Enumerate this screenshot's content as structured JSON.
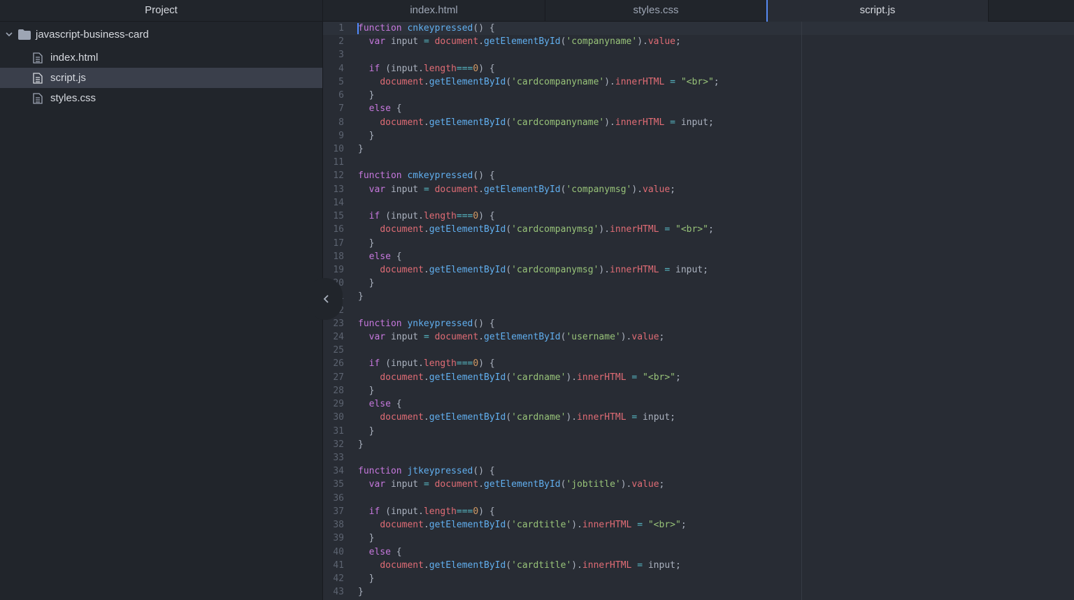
{
  "sidebar": {
    "title": "Project",
    "folder": {
      "name": "javascript-business-card",
      "expanded": true
    },
    "files": [
      {
        "name": "index.html",
        "selected": false
      },
      {
        "name": "script.js",
        "selected": true
      },
      {
        "name": "styles.css",
        "selected": false
      }
    ]
  },
  "tabs": [
    {
      "label": "index.html",
      "active": false
    },
    {
      "label": "styles.css",
      "active": false
    },
    {
      "label": "script.js",
      "active": true
    }
  ],
  "editor": {
    "first_line_number": 1,
    "colors": {
      "keyword": "#c678dd",
      "function": "#61afef",
      "variable": "#e06c75",
      "string": "#98c379",
      "number": "#d19a66",
      "operator": "#56b6c2",
      "text": "#abb2bf",
      "cursor": "#528bff"
    },
    "lines": [
      [
        [
          "k",
          "function"
        ],
        [
          "p",
          " "
        ],
        [
          "f",
          "cnkeypressed"
        ],
        [
          "p",
          "() {"
        ]
      ],
      [
        [
          "p",
          "  "
        ],
        [
          "k",
          "var"
        ],
        [
          "p",
          " input "
        ],
        [
          "o",
          "="
        ],
        [
          "p",
          " "
        ],
        [
          "v",
          "document"
        ],
        [
          "p",
          "."
        ],
        [
          "f",
          "getElementById"
        ],
        [
          "p",
          "("
        ],
        [
          "s",
          "'companyname'"
        ],
        [
          "p",
          ")."
        ],
        [
          "v",
          "value"
        ],
        [
          "p",
          ";"
        ]
      ],
      [],
      [
        [
          "p",
          "  "
        ],
        [
          "k",
          "if"
        ],
        [
          "p",
          " (input."
        ],
        [
          "v",
          "length"
        ],
        [
          "o",
          "==="
        ],
        [
          "n",
          "0"
        ],
        [
          "p",
          ") {"
        ]
      ],
      [
        [
          "p",
          "    "
        ],
        [
          "v",
          "document"
        ],
        [
          "p",
          "."
        ],
        [
          "f",
          "getElementById"
        ],
        [
          "p",
          "("
        ],
        [
          "s",
          "'cardcompanyname'"
        ],
        [
          "p",
          ")."
        ],
        [
          "v",
          "innerHTML"
        ],
        [
          "p",
          " "
        ],
        [
          "o",
          "="
        ],
        [
          "p",
          " "
        ],
        [
          "s",
          "\"<br>\""
        ],
        [
          "p",
          ";"
        ]
      ],
      [
        [
          "p",
          "  }"
        ]
      ],
      [
        [
          "p",
          "  "
        ],
        [
          "k",
          "else"
        ],
        [
          "p",
          " {"
        ]
      ],
      [
        [
          "p",
          "    "
        ],
        [
          "v",
          "document"
        ],
        [
          "p",
          "."
        ],
        [
          "f",
          "getElementById"
        ],
        [
          "p",
          "("
        ],
        [
          "s",
          "'cardcompanyname'"
        ],
        [
          "p",
          ")."
        ],
        [
          "v",
          "innerHTML"
        ],
        [
          "p",
          " "
        ],
        [
          "o",
          "="
        ],
        [
          "p",
          " input;"
        ]
      ],
      [
        [
          "p",
          "  }"
        ]
      ],
      [
        [
          "p",
          "}"
        ]
      ],
      [],
      [
        [
          "k",
          "function"
        ],
        [
          "p",
          " "
        ],
        [
          "f",
          "cmkeypressed"
        ],
        [
          "p",
          "() {"
        ]
      ],
      [
        [
          "p",
          "  "
        ],
        [
          "k",
          "var"
        ],
        [
          "p",
          " input "
        ],
        [
          "o",
          "="
        ],
        [
          "p",
          " "
        ],
        [
          "v",
          "document"
        ],
        [
          "p",
          "."
        ],
        [
          "f",
          "getElementById"
        ],
        [
          "p",
          "("
        ],
        [
          "s",
          "'companymsg'"
        ],
        [
          "p",
          ")."
        ],
        [
          "v",
          "value"
        ],
        [
          "p",
          ";"
        ]
      ],
      [],
      [
        [
          "p",
          "  "
        ],
        [
          "k",
          "if"
        ],
        [
          "p",
          " (input."
        ],
        [
          "v",
          "length"
        ],
        [
          "o",
          "==="
        ],
        [
          "n",
          "0"
        ],
        [
          "p",
          ") {"
        ]
      ],
      [
        [
          "p",
          "    "
        ],
        [
          "v",
          "document"
        ],
        [
          "p",
          "."
        ],
        [
          "f",
          "getElementById"
        ],
        [
          "p",
          "("
        ],
        [
          "s",
          "'cardcompanymsg'"
        ],
        [
          "p",
          ")."
        ],
        [
          "v",
          "innerHTML"
        ],
        [
          "p",
          " "
        ],
        [
          "o",
          "="
        ],
        [
          "p",
          " "
        ],
        [
          "s",
          "\"<br>\""
        ],
        [
          "p",
          ";"
        ]
      ],
      [
        [
          "p",
          "  }"
        ]
      ],
      [
        [
          "p",
          "  "
        ],
        [
          "k",
          "else"
        ],
        [
          "p",
          " {"
        ]
      ],
      [
        [
          "p",
          "    "
        ],
        [
          "v",
          "document"
        ],
        [
          "p",
          "."
        ],
        [
          "f",
          "getElementById"
        ],
        [
          "p",
          "("
        ],
        [
          "s",
          "'cardcompanymsg'"
        ],
        [
          "p",
          ")."
        ],
        [
          "v",
          "innerHTML"
        ],
        [
          "p",
          " "
        ],
        [
          "o",
          "="
        ],
        [
          "p",
          " input;"
        ]
      ],
      [
        [
          "p",
          "  }"
        ]
      ],
      [
        [
          "p",
          "}"
        ]
      ],
      [],
      [
        [
          "k",
          "function"
        ],
        [
          "p",
          " "
        ],
        [
          "f",
          "ynkeypressed"
        ],
        [
          "p",
          "() {"
        ]
      ],
      [
        [
          "p",
          "  "
        ],
        [
          "k",
          "var"
        ],
        [
          "p",
          " input "
        ],
        [
          "o",
          "="
        ],
        [
          "p",
          " "
        ],
        [
          "v",
          "document"
        ],
        [
          "p",
          "."
        ],
        [
          "f",
          "getElementById"
        ],
        [
          "p",
          "("
        ],
        [
          "s",
          "'username'"
        ],
        [
          "p",
          ")."
        ],
        [
          "v",
          "value"
        ],
        [
          "p",
          ";"
        ]
      ],
      [],
      [
        [
          "p",
          "  "
        ],
        [
          "k",
          "if"
        ],
        [
          "p",
          " (input."
        ],
        [
          "v",
          "length"
        ],
        [
          "o",
          "==="
        ],
        [
          "n",
          "0"
        ],
        [
          "p",
          ") {"
        ]
      ],
      [
        [
          "p",
          "    "
        ],
        [
          "v",
          "document"
        ],
        [
          "p",
          "."
        ],
        [
          "f",
          "getElementById"
        ],
        [
          "p",
          "("
        ],
        [
          "s",
          "'cardname'"
        ],
        [
          "p",
          ")."
        ],
        [
          "v",
          "innerHTML"
        ],
        [
          "p",
          " "
        ],
        [
          "o",
          "="
        ],
        [
          "p",
          " "
        ],
        [
          "s",
          "\"<br>\""
        ],
        [
          "p",
          ";"
        ]
      ],
      [
        [
          "p",
          "  }"
        ]
      ],
      [
        [
          "p",
          "  "
        ],
        [
          "k",
          "else"
        ],
        [
          "p",
          " {"
        ]
      ],
      [
        [
          "p",
          "    "
        ],
        [
          "v",
          "document"
        ],
        [
          "p",
          "."
        ],
        [
          "f",
          "getElementById"
        ],
        [
          "p",
          "("
        ],
        [
          "s",
          "'cardname'"
        ],
        [
          "p",
          ")."
        ],
        [
          "v",
          "innerHTML"
        ],
        [
          "p",
          " "
        ],
        [
          "o",
          "="
        ],
        [
          "p",
          " input;"
        ]
      ],
      [
        [
          "p",
          "  }"
        ]
      ],
      [
        [
          "p",
          "}"
        ]
      ],
      [],
      [
        [
          "k",
          "function"
        ],
        [
          "p",
          " "
        ],
        [
          "f",
          "jtkeypressed"
        ],
        [
          "p",
          "() {"
        ]
      ],
      [
        [
          "p",
          "  "
        ],
        [
          "k",
          "var"
        ],
        [
          "p",
          " input "
        ],
        [
          "o",
          "="
        ],
        [
          "p",
          " "
        ],
        [
          "v",
          "document"
        ],
        [
          "p",
          "."
        ],
        [
          "f",
          "getElementById"
        ],
        [
          "p",
          "("
        ],
        [
          "s",
          "'jobtitle'"
        ],
        [
          "p",
          ")."
        ],
        [
          "v",
          "value"
        ],
        [
          "p",
          ";"
        ]
      ],
      [],
      [
        [
          "p",
          "  "
        ],
        [
          "k",
          "if"
        ],
        [
          "p",
          " (input."
        ],
        [
          "v",
          "length"
        ],
        [
          "o",
          "==="
        ],
        [
          "n",
          "0"
        ],
        [
          "p",
          ") {"
        ]
      ],
      [
        [
          "p",
          "    "
        ],
        [
          "v",
          "document"
        ],
        [
          "p",
          "."
        ],
        [
          "f",
          "getElementById"
        ],
        [
          "p",
          "("
        ],
        [
          "s",
          "'cardtitle'"
        ],
        [
          "p",
          ")."
        ],
        [
          "v",
          "innerHTML"
        ],
        [
          "p",
          " "
        ],
        [
          "o",
          "="
        ],
        [
          "p",
          " "
        ],
        [
          "s",
          "\"<br>\""
        ],
        [
          "p",
          ";"
        ]
      ],
      [
        [
          "p",
          "  }"
        ]
      ],
      [
        [
          "p",
          "  "
        ],
        [
          "k",
          "else"
        ],
        [
          "p",
          " {"
        ]
      ],
      [
        [
          "p",
          "    "
        ],
        [
          "v",
          "document"
        ],
        [
          "p",
          "."
        ],
        [
          "f",
          "getElementById"
        ],
        [
          "p",
          "("
        ],
        [
          "s",
          "'cardtitle'"
        ],
        [
          "p",
          ")."
        ],
        [
          "v",
          "innerHTML"
        ],
        [
          "p",
          " "
        ],
        [
          "o",
          "="
        ],
        [
          "p",
          " input;"
        ]
      ],
      [
        [
          "p",
          "  }"
        ]
      ],
      [
        [
          "p",
          "}"
        ]
      ]
    ]
  }
}
